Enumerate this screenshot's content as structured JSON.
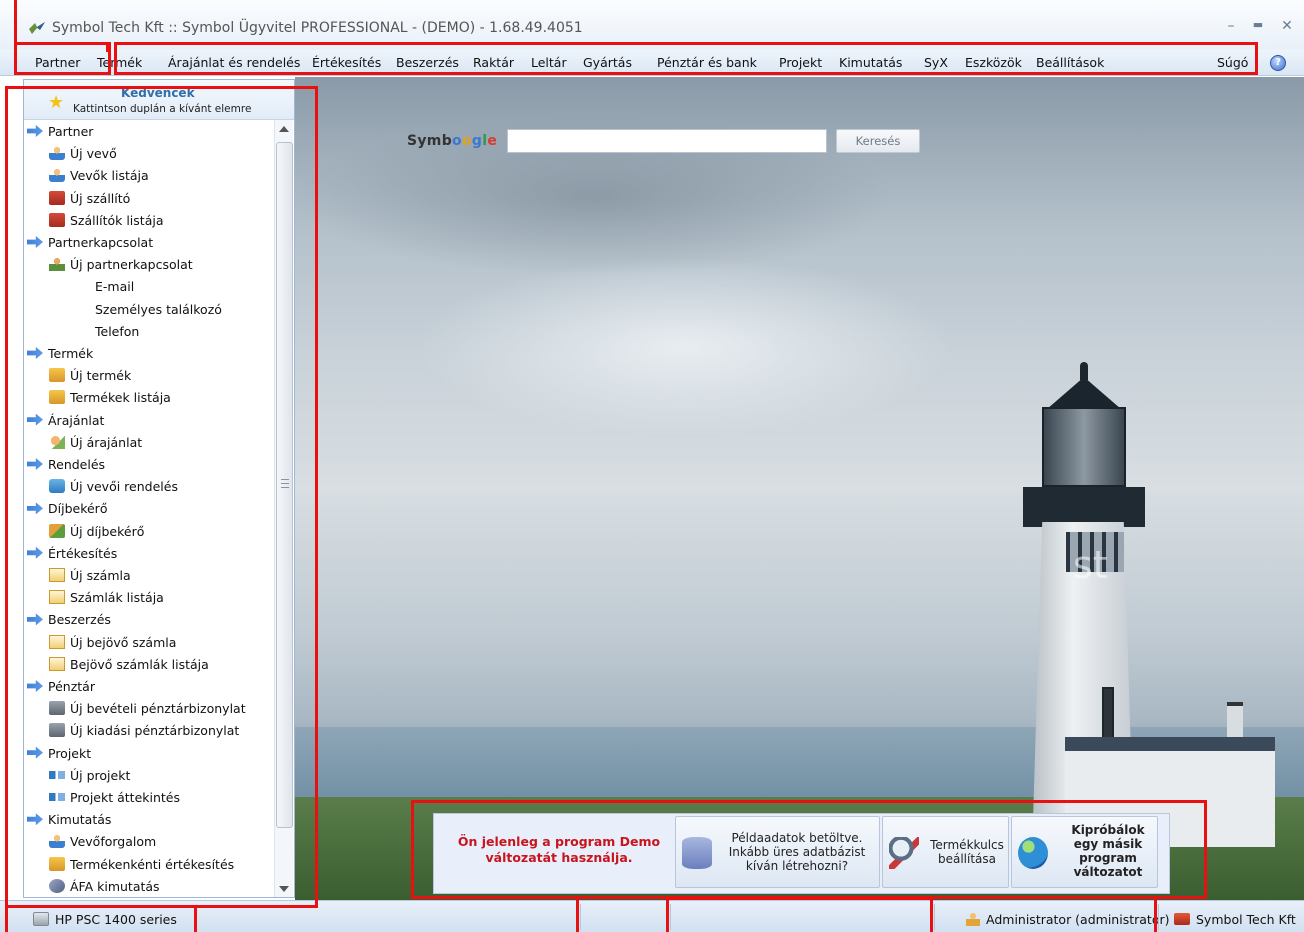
{
  "window": {
    "title": "Symbol Tech Kft :: Symbol Ügyvitel PROFESSIONAL - (DEMO) - 1.68.49.4051",
    "minimize_glyph": "–",
    "maximize_glyph": "▬",
    "close_glyph": "✕"
  },
  "menu": {
    "items": [
      "Partner",
      "Termék",
      "Árajánlat és rendelés",
      "Értékesítés",
      "Beszerzés",
      "Raktár",
      "Leltár",
      "Gyártás",
      "Pénztár és bank",
      "Projekt",
      "Kimutatás",
      "SyX",
      "Eszközök",
      "Beállítások",
      "Súgó"
    ],
    "help_glyph": "?"
  },
  "sidebar": {
    "title": "Kedvencek",
    "subtitle": "Kattintson duplán a kívánt elemre",
    "items": [
      {
        "label": "Partner",
        "level": 0,
        "icon": "arrow-right-icon"
      },
      {
        "label": "Új vevő",
        "level": 1,
        "icon": "new-customer-icon"
      },
      {
        "label": "Vevők listája",
        "level": 1,
        "icon": "customer-icon"
      },
      {
        "label": "Új szállító",
        "level": 1,
        "icon": "new-supplier-icon"
      },
      {
        "label": "Szállítók listája",
        "level": 1,
        "icon": "supplier-icon"
      },
      {
        "label": "Partnerkapcsolat",
        "level": 0,
        "icon": "arrow-right-icon"
      },
      {
        "label": "Új partnerkapcsolat",
        "level": 1,
        "icon": "new-contact-icon"
      },
      {
        "label": "E-mail",
        "level": 2,
        "icon": ""
      },
      {
        "label": "Személyes találkozó",
        "level": 2,
        "icon": ""
      },
      {
        "label": "Telefon",
        "level": 2,
        "icon": ""
      },
      {
        "label": "Termék",
        "level": 0,
        "icon": "arrow-right-icon"
      },
      {
        "label": "Új termék",
        "level": 1,
        "icon": "new-product-icon"
      },
      {
        "label": "Termékek listája",
        "level": 1,
        "icon": "product-icon"
      },
      {
        "label": "Árajánlat",
        "level": 0,
        "icon": "arrow-right-icon"
      },
      {
        "label": "Új árajánlat",
        "level": 1,
        "icon": "new-quote-icon"
      },
      {
        "label": "Rendelés",
        "level": 0,
        "icon": "arrow-right-icon"
      },
      {
        "label": "Új vevői rendelés",
        "level": 1,
        "icon": "new-order-icon"
      },
      {
        "label": "Díjbekérő",
        "level": 0,
        "icon": "arrow-right-icon"
      },
      {
        "label": "Új díjbekérő",
        "level": 1,
        "icon": "new-proforma-icon"
      },
      {
        "label": "Értékesítés",
        "level": 0,
        "icon": "arrow-right-icon"
      },
      {
        "label": "Új számla",
        "level": 1,
        "icon": "new-invoice-icon"
      },
      {
        "label": "Számlák listája",
        "level": 1,
        "icon": "invoice-icon"
      },
      {
        "label": "Beszerzés",
        "level": 0,
        "icon": "arrow-right-icon"
      },
      {
        "label": "Új bejövő számla",
        "level": 1,
        "icon": "new-incoming-invoice-icon"
      },
      {
        "label": "Bejövő számlák listája",
        "level": 1,
        "icon": "incoming-invoice-icon"
      },
      {
        "label": "Pénztár",
        "level": 0,
        "icon": "arrow-right-icon"
      },
      {
        "label": "Új bevételi pénztárbizonylat",
        "level": 1,
        "icon": "cash-in-icon"
      },
      {
        "label": "Új kiadási pénztárbizonylat",
        "level": 1,
        "icon": "cash-out-icon"
      },
      {
        "label": "Projekt",
        "level": 0,
        "icon": "arrow-right-icon"
      },
      {
        "label": "Új projekt",
        "level": 1,
        "icon": "new-project-icon"
      },
      {
        "label": "Projekt áttekintés",
        "level": 1,
        "icon": "project-icon"
      },
      {
        "label": "Kimutatás",
        "level": 0,
        "icon": "arrow-right-icon"
      },
      {
        "label": "Vevőforgalom",
        "level": 1,
        "icon": "customer-turnover-icon"
      },
      {
        "label": "Termékenkénti értékesítés",
        "level": 1,
        "icon": "product-sales-icon"
      },
      {
        "label": "ÁFA kimutatás",
        "level": 1,
        "icon": "vat-report-icon"
      }
    ]
  },
  "search": {
    "brand": [
      "Symb",
      "o",
      "o",
      "g",
      "l",
      "e"
    ],
    "value": "",
    "button_label": "Keresés"
  },
  "demo_banner": {
    "message": "Ön jelenleg a program Demo változatát használja.",
    "card1_text": "Példaadatok betöltve. Inkább üres adatbázist kíván létrehozni?",
    "card2_text": "Termékkulcs beállítása",
    "card3_text": "Kipróbálok egy másik program változatot"
  },
  "status": {
    "printer": "HP PSC 1400 series",
    "user": "Administrator (administrator)",
    "company": "Symbol Tech Kft"
  },
  "background_watermark": "st",
  "colors": {
    "accent_red": "#c8141c",
    "sidebar_title": "#2f6ea8",
    "annotation_red": "#e81010"
  }
}
